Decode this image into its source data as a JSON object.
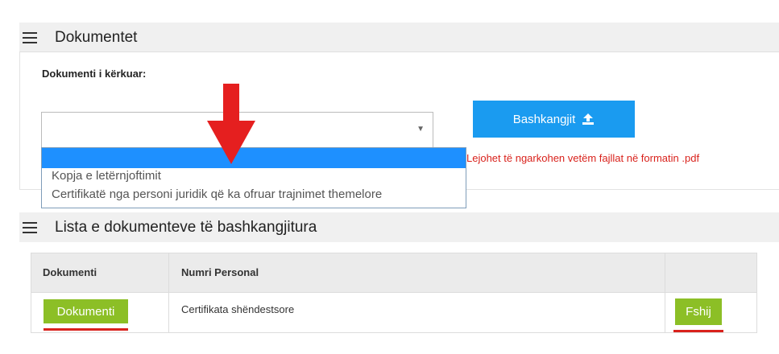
{
  "documents_panel": {
    "title": "Dokumentet",
    "required_label": "Dokumenti i kërkuar:",
    "select": {
      "value": "",
      "options": [
        "",
        "Kopja e letërnjoftimit",
        "Certifikatë nga personi juridik që ka ofruar trajnimet themelore"
      ]
    },
    "attach_button": {
      "label": "Bashkangjit",
      "icon": "upload-icon"
    },
    "warning": "Lejohet të ngarkohen vetëm fajllat në formatin .pdf"
  },
  "attached_panel": {
    "title": "Lista e dokumenteve të bashkangjitura",
    "columns": [
      "Dokumenti",
      "Numri Personal",
      ""
    ],
    "rows": [
      {
        "document_button": "Dokumenti",
        "numri_personal": "Certifikata shëndestsore",
        "delete_button": "Fshij"
      }
    ]
  },
  "colors": {
    "accent_blue": "#1a9bf0",
    "highlight_blue": "#1e90ff",
    "green": "#8cbf26",
    "red": "#d9221c",
    "header_gray": "#f0f0f0"
  }
}
